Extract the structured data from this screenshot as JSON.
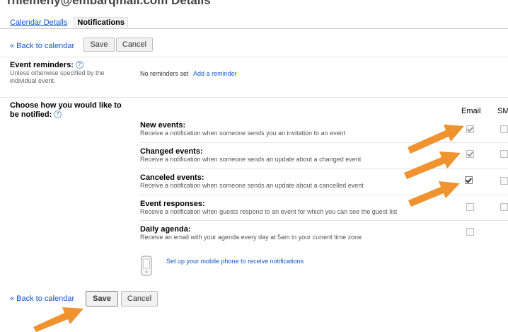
{
  "header": {
    "title": "rhiemeny@embarqmail.com Details"
  },
  "tabs": [
    {
      "label": "Calendar Details"
    },
    {
      "label": "Notifications"
    }
  ],
  "toolbar": {
    "back_label": "« Back to calendar",
    "save_label": "Save",
    "cancel_label": "Cancel"
  },
  "event_reminders": {
    "title": "Event reminders:",
    "desc": "Unless otherwise specified by the individual event.",
    "status": "No reminders set",
    "add_link": "Add a reminder"
  },
  "notify": {
    "title": "Choose how you would like to be notified:",
    "columns": [
      "Email",
      "SM"
    ],
    "rows": [
      {
        "title": "New events:",
        "desc": "Receive a notification when someone sends you an invitation to an event",
        "email": true,
        "sms": false
      },
      {
        "title": "Changed events:",
        "desc": "Receive a notification when someone sends an update about a changed event",
        "email": true,
        "sms": false
      },
      {
        "title": "Canceled events:",
        "desc": "Receive a notification when someone sends an update about a cancelled event",
        "email": true,
        "sms": false
      },
      {
        "title": "Event responses:",
        "desc": "Receive a notification when guests respond to an event for which you can see the guest list",
        "email": false,
        "sms": false
      },
      {
        "title": "Daily agenda:",
        "desc": "Receive an email with your agenda every day at 5am in your current time zone",
        "email": false,
        "sms": null
      }
    ],
    "mobile_link": "Set up your mobile phone to receive notifications"
  },
  "footer": {
    "back_label": "« Back to calendar",
    "save_label": "Save",
    "cancel_label": "Cancel"
  },
  "annotation_color": "#f0922e"
}
